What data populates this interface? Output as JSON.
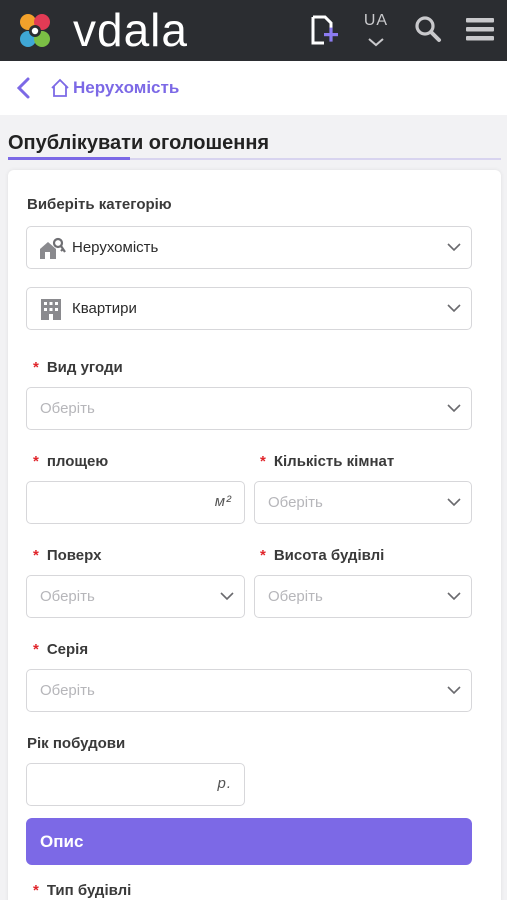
{
  "header": {
    "brand": "vdala",
    "language": "UA",
    "icons": [
      "logo-icon",
      "add-listing-icon",
      "chevron-down-icon",
      "search-icon",
      "menu-icon"
    ]
  },
  "breadcrumb": {
    "label": "Нерухомість"
  },
  "page": {
    "title": "Опублікувати оголошення"
  },
  "form": {
    "category_label": "Виберіть категорію",
    "category_value": "Нерухомість",
    "subcategory_value": "Квартири",
    "deal_type": {
      "label": "Вид угоди",
      "placeholder": "Оберіть"
    },
    "area": {
      "label": "площею",
      "unit": "м²"
    },
    "rooms": {
      "label": "Кількість кімнат",
      "placeholder": "Оберіть"
    },
    "floor": {
      "label": "Поверх",
      "placeholder": "Оберіть"
    },
    "building_height": {
      "label": "Висота будівлі",
      "placeholder": "Оберіть"
    },
    "series": {
      "label": "Серія",
      "placeholder": "Оберіть"
    },
    "build_year": {
      "label": "Рік побудови",
      "unit": "р."
    },
    "description_button": "Опис",
    "building_type": {
      "label": "Тип будівлі"
    },
    "required_mark": "*"
  },
  "colors": {
    "accent": "#7c69e6",
    "header_bg": "#2b2d31",
    "required": "#e0242a"
  }
}
